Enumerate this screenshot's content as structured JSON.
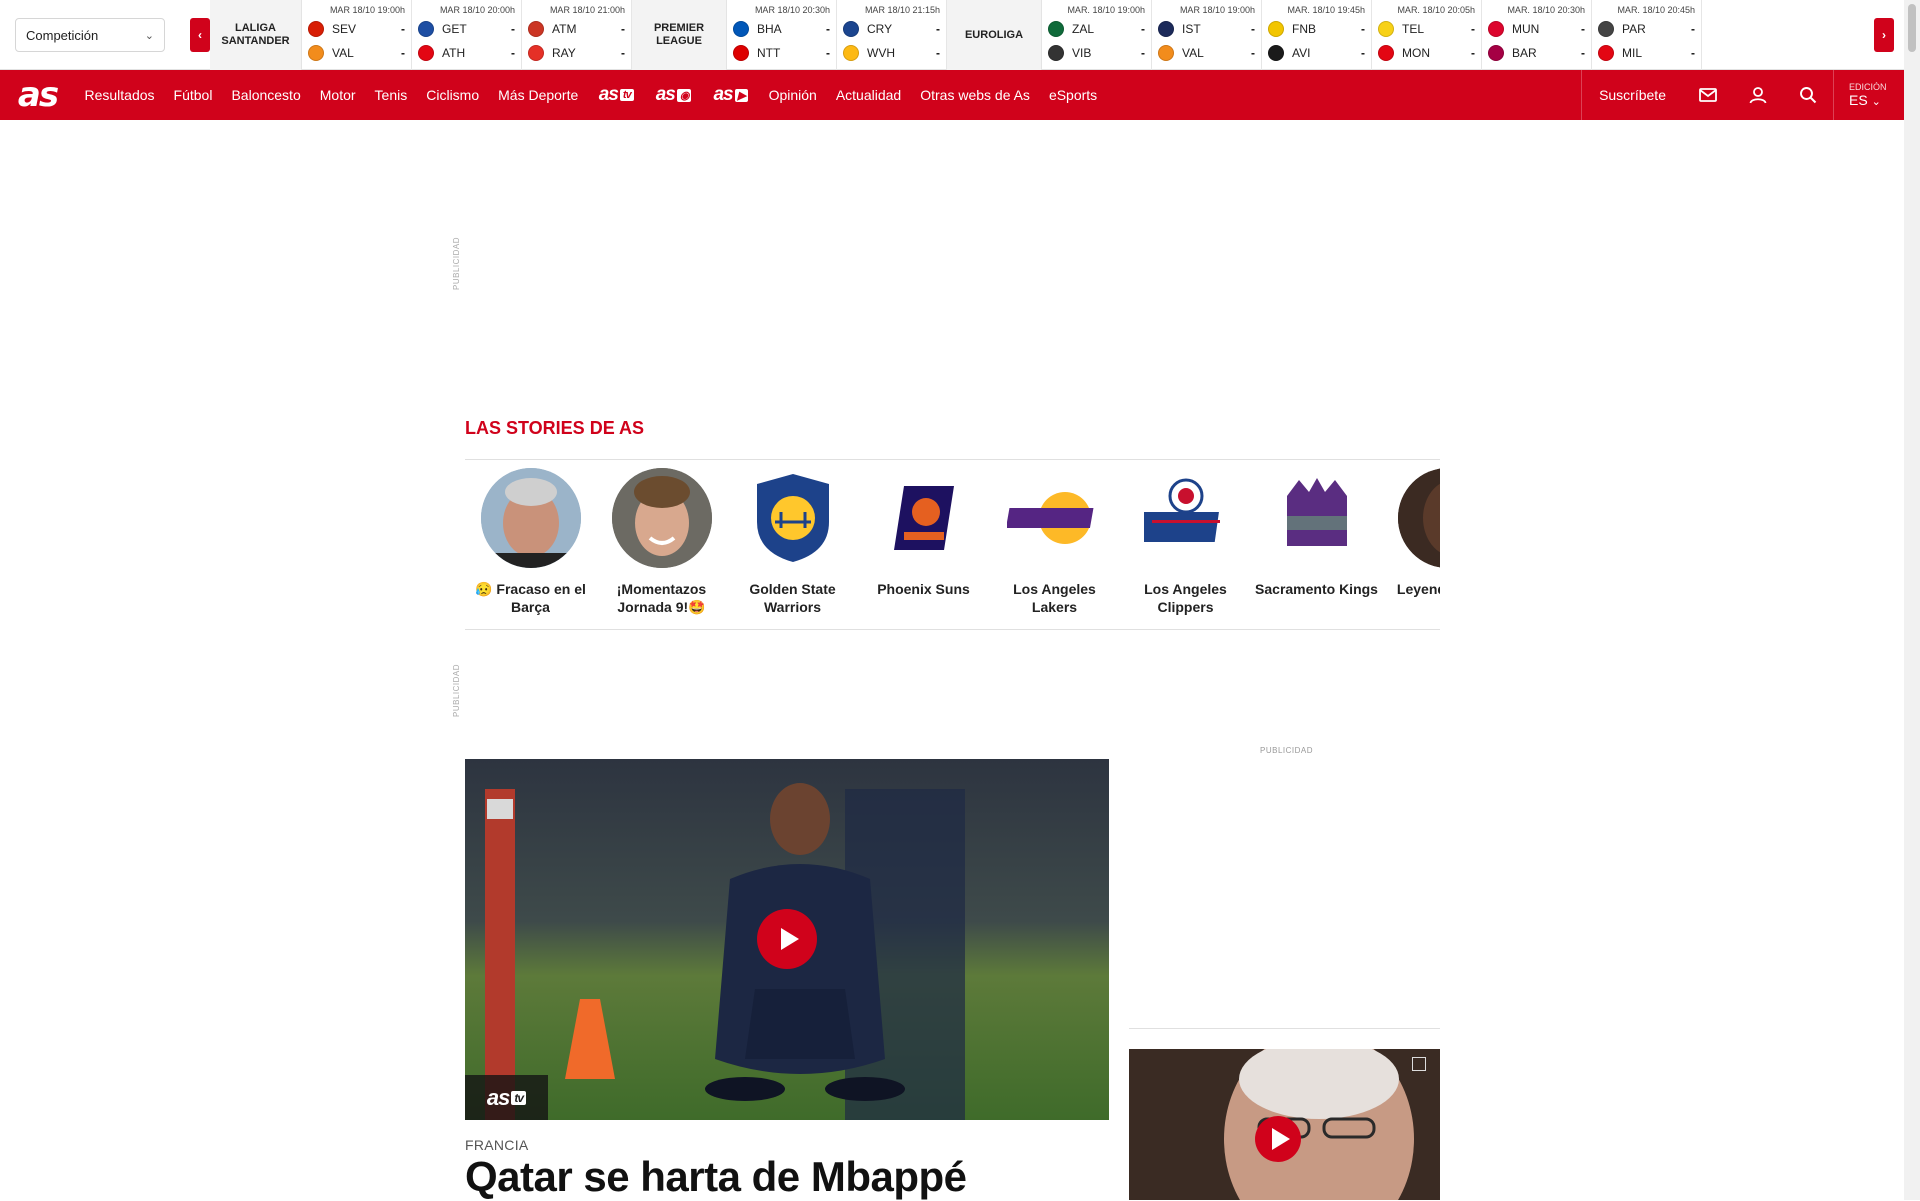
{
  "scores_bar": {
    "competition_select": "Competición",
    "prev_label": "‹",
    "next_label": "›",
    "groups": [
      {
        "league": "LALIGA SANTANDER",
        "matches": [
          {
            "time": "MAR 18/10 19:00h",
            "home": "SEV",
            "away": "VAL",
            "home_score": "-",
            "away_score": "-",
            "home_color": "#d81e05",
            "away_color": "#f28c1c"
          },
          {
            "time": "MAR 18/10 20:00h",
            "home": "GET",
            "away": "ATH",
            "home_score": "-",
            "away_score": "-",
            "home_color": "#1d4ea3",
            "away_color": "#e30613"
          },
          {
            "time": "MAR 18/10 21:00h",
            "home": "ATM",
            "away": "RAY",
            "home_score": "-",
            "away_score": "-",
            "home_color": "#cb3524",
            "away_color": "#e53027"
          }
        ]
      },
      {
        "league": "PREMIER LEAGUE",
        "matches": [
          {
            "time": "MAR 18/10 20:30h",
            "home": "BHA",
            "away": "NTT",
            "home_score": "-",
            "away_score": "-",
            "home_color": "#0057b8",
            "away_color": "#dd0000"
          },
          {
            "time": "MAR 18/10 21:15h",
            "home": "CRY",
            "away": "WVH",
            "home_score": "-",
            "away_score": "-",
            "home_color": "#1b458f",
            "away_color": "#fdb913"
          }
        ]
      },
      {
        "league": "EUROLIGA",
        "matches": [
          {
            "time": "MAR. 18/10 19:00h",
            "home": "ZAL",
            "away": "VIB",
            "home_score": "-",
            "away_score": "-",
            "home_color": "#0f6a3a",
            "away_color": "#333333"
          },
          {
            "time": "MAR 18/10 19:00h",
            "home": "IST",
            "away": "VAL",
            "home_score": "-",
            "away_score": "-",
            "home_color": "#1c2a5a",
            "away_color": "#f28c1c"
          },
          {
            "time": "MAR. 18/10 19:45h",
            "home": "FNB",
            "away": "AVI",
            "home_score": "-",
            "away_score": "-",
            "home_color": "#f2c500",
            "away_color": "#1a1a1a"
          },
          {
            "time": "MAR. 18/10 20:05h",
            "home": "TEL",
            "away": "MON",
            "home_score": "-",
            "away_score": "-",
            "home_color": "#f7d117",
            "away_color": "#e30613"
          },
          {
            "time": "MAR. 18/10 20:30h",
            "home": "MUN",
            "away": "BAR",
            "home_score": "-",
            "away_score": "-",
            "home_color": "#dc052d",
            "away_color": "#a50044"
          },
          {
            "time": "MAR. 18/10 20:45h",
            "home": "PAR",
            "away": "MIL",
            "home_score": "-",
            "away_score": "-",
            "home_color": "#444444",
            "away_color": "#e30613"
          }
        ]
      }
    ]
  },
  "nav": {
    "logo": "as",
    "items": [
      "Resultados",
      "Fútbol",
      "Baloncesto",
      "Motor",
      "Tenis",
      "Ciclismo",
      "Más Deporte"
    ],
    "brands": [
      {
        "main": "as",
        "sub": "tv"
      },
      {
        "main": "as",
        "sub": "◉"
      },
      {
        "main": "as",
        "sub": "▶"
      }
    ],
    "items2": [
      "Opinión",
      "Actualidad",
      "Otras webs de As",
      "eSports"
    ],
    "subscribe": "Suscríbete",
    "edition_label": "EDICIÓN",
    "edition_value": "ES",
    "icons": [
      "mail-icon",
      "user-icon",
      "search-icon"
    ],
    "accent_color": "#d0021b"
  },
  "ads": {
    "label": "PUBLICIDAD"
  },
  "stories": {
    "title": "LAS STORIES DE AS",
    "items": [
      {
        "caption": "😥 Fracaso en el Barça",
        "bg": "#9bb4c9"
      },
      {
        "caption": "¡Momentazos Jornada 9!🤩",
        "bg": "#6c6a63"
      },
      {
        "caption": "Golden State Warriors",
        "bg": "#ffffff"
      },
      {
        "caption": "Phoenix Suns",
        "bg": "#ffffff"
      },
      {
        "caption": "Los Angeles Lakers",
        "bg": "#ffffff"
      },
      {
        "caption": "Los Angeles Clippers",
        "bg": "#ffffff"
      },
      {
        "caption": "Sacramento Kings",
        "bg": "#ffffff"
      },
      {
        "caption": "Leyendas mate",
        "bg": "#3b2a22"
      }
    ]
  },
  "main_article": {
    "badge_main": "as",
    "badge_sub": "tv",
    "kicker": "FRANCIA",
    "headline": "Qatar se harta de Mbappé"
  }
}
